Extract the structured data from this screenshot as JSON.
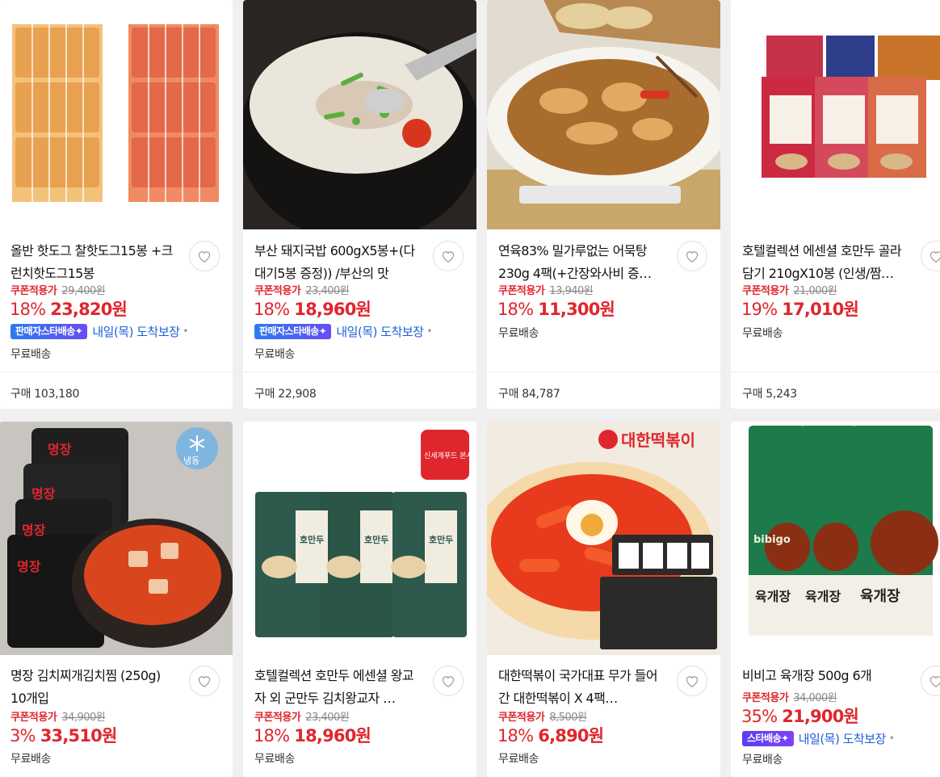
{
  "colors": {
    "accent_red": "#e0262d",
    "delivery_blue": "#1d5fd9",
    "background": "#f0f0f0"
  },
  "products": [
    {
      "title": "올반 핫도그 찰핫도그15봉 +크런치핫도그15봉",
      "coupon_label": "쿠폰적용가",
      "original_price": "29,400원",
      "discount": "18%",
      "price": "23,820원",
      "badge": "판매자스타배송✦",
      "arrival": "내일(목) 도착보장",
      "shipping": "무료배송",
      "purchases": "구매 103,180"
    },
    {
      "title": "부산 돼지국밥 600gX5봉+(다대기5봉 증정)) /부산의 맛",
      "coupon_label": "쿠폰적용가",
      "original_price": "23,400원",
      "discount": "18%",
      "price": "18,960원",
      "badge": "판매자스타배송✦",
      "arrival": "내일(목) 도착보장",
      "shipping": "무료배송",
      "purchases": "구매 22,908"
    },
    {
      "title": "연육83% 밀가루없는 어묵탕 230g 4팩(+간장와사비 증…",
      "coupon_label": "쿠폰적용가",
      "original_price": "13,940원",
      "discount": "18%",
      "price": "11,300원",
      "shipping": "무료배송",
      "purchases": "구매 84,787"
    },
    {
      "title": "호텔컬렉션 에센셜 호만두 골라담기 210gX10봉 (인생/짬…",
      "coupon_label": "쿠폰적용가",
      "original_price": "21,000원",
      "discount": "19%",
      "price": "17,010원",
      "shipping": "무료배송",
      "purchases": "구매 5,243"
    },
    {
      "title": "명장 김치찌개김치찜 (250g) 10개입",
      "image_tag": "냉동",
      "coupon_label": "쿠폰적용가",
      "original_price": "34,900원",
      "discount": "3%",
      "price": "33,510원",
      "shipping": "무료배송"
    },
    {
      "title": "호텔컬렉션 호만두 에센셜 왕교자 외 군만두 김치왕교자 …",
      "image_tag": "신세계푸드 본사직영몰",
      "coupon_label": "쿠폰적용가",
      "original_price": "23,400원",
      "discount": "18%",
      "price": "18,960원",
      "shipping": "무료배송"
    },
    {
      "title": "대한떡볶이 국가대표 무가 들어간 대한떡볶이 X 4팩…",
      "image_tag": "대한떡볶이",
      "coupon_label": "쿠폰적용가",
      "original_price": "8,500원",
      "discount": "18%",
      "price": "6,890원",
      "shipping": "무료배송"
    },
    {
      "title": "비비고 육개장 500g 6개",
      "coupon_label": "쿠폰적용가",
      "original_price": "34,000원",
      "discount": "35%",
      "price": "21,900원",
      "badge": "스타배송✦",
      "arrival": "내일(목) 도착보장",
      "shipping": "무료배송"
    }
  ],
  "image_texts": {
    "p5_brand": "명장",
    "p6_label": "호만두",
    "p8_brand": "bibigo",
    "p8_label": "육개장"
  }
}
